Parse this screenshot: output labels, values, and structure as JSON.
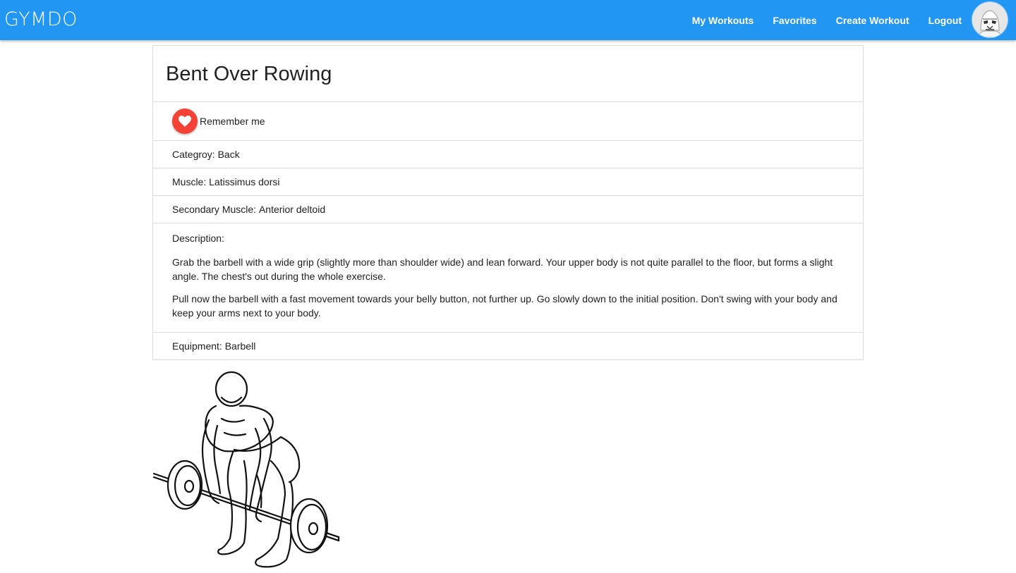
{
  "brand": "GYMDO",
  "nav": {
    "links": [
      "My Workouts",
      "Favorites",
      "Create Workout",
      "Logout"
    ]
  },
  "exercise": {
    "title": "Bent Over Rowing",
    "favorite_label": "Remember me",
    "category_label": "Categroy:",
    "category": "Back",
    "muscle_label": "Muscle:",
    "muscle": "Latissimus dorsi",
    "secondary_label": "Secondary Muscle:",
    "secondary_muscle": "Anterior deltoid",
    "description_label": "Description:",
    "description": [
      "Grab the barbell with a wide grip (slightly more than shoulder wide) and lean forward. Your upper body is not quite parallel to the floor, but forms a slight angle. The chest's out during the whole exercise.",
      "Pull now the barbell with a fast movement towards your belly button, not further up. Go slowly down to the initial position. Don't swing with your body and keep your arms next to your body."
    ],
    "equipment_label": "Equipment:",
    "equipment": "Barbell"
  },
  "icons": {
    "favorite": "heart-icon",
    "avatar": "stormtrooper-avatar-icon"
  },
  "colors": {
    "navbar": "#2196f3",
    "favorite_button": "#f44336"
  }
}
